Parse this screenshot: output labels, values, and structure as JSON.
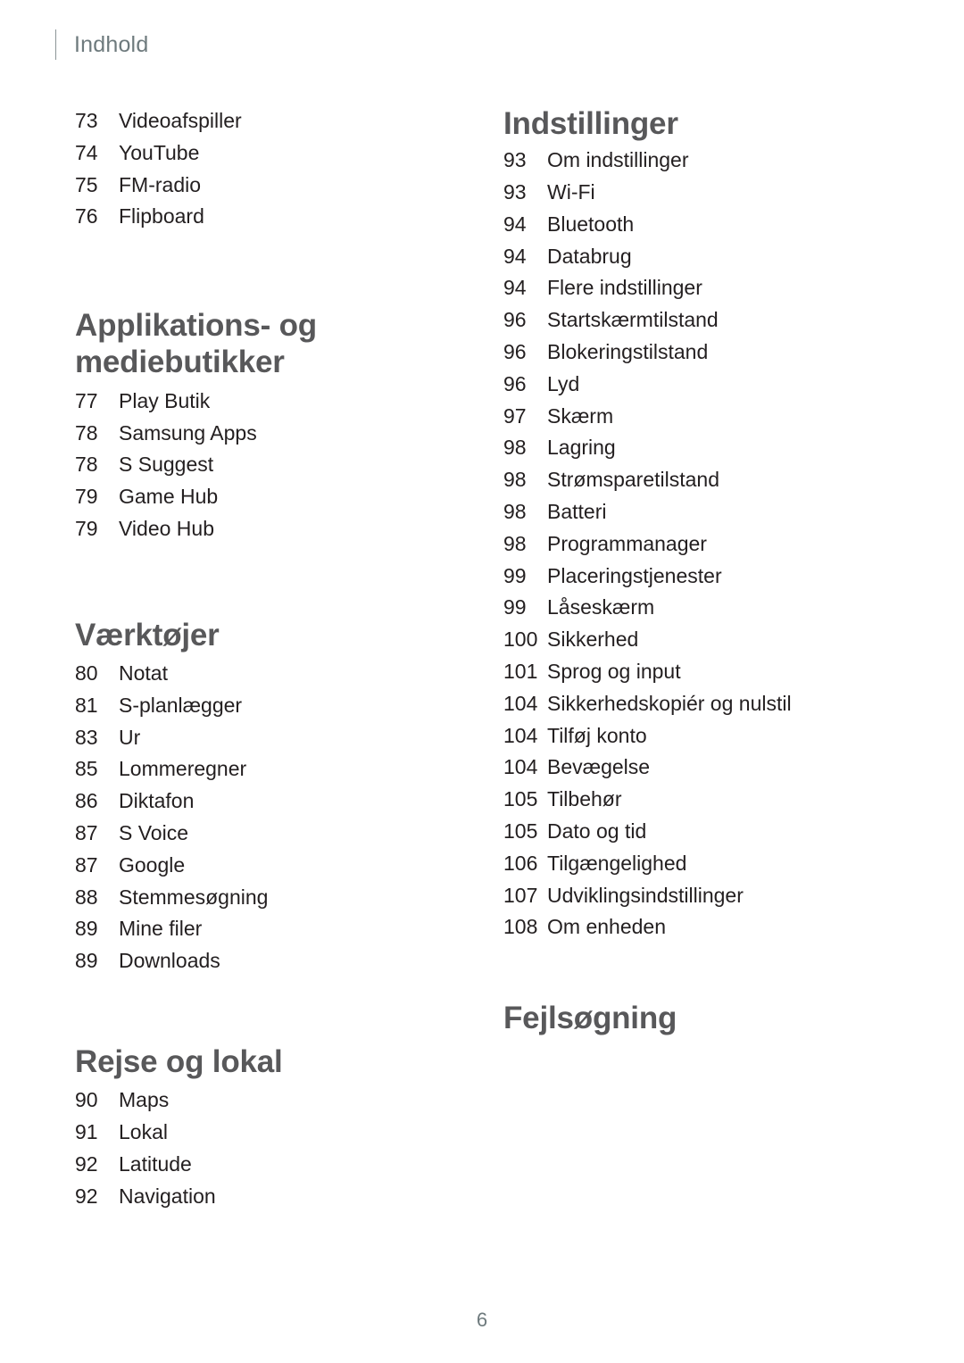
{
  "header": {
    "title": "Indhold"
  },
  "folio": {
    "page_number": "6"
  },
  "colors": {
    "heading": "#58585a",
    "body_text": "#231f20",
    "header_text": "#6e7a7d",
    "rule": "#8c9597",
    "background": "#ffffff"
  },
  "left_column": {
    "intro_entries": [
      {
        "page": "73",
        "label": "Videoafspiller"
      },
      {
        "page": "74",
        "label": "YouTube"
      },
      {
        "page": "75",
        "label": "FM-radio"
      },
      {
        "page": "76",
        "label": "Flipboard"
      }
    ],
    "sections": [
      {
        "heading": "Applikations- og mediebutikker",
        "heading_line_1": "Applikations- og",
        "heading_line_2": "mediebutikker",
        "entries": [
          {
            "page": "77",
            "label": "Play Butik"
          },
          {
            "page": "78",
            "label": "Samsung Apps"
          },
          {
            "page": "78",
            "label": "S Suggest"
          },
          {
            "page": "79",
            "label": "Game Hub"
          },
          {
            "page": "79",
            "label": "Video Hub"
          }
        ]
      },
      {
        "heading": "Værktøjer",
        "entries": [
          {
            "page": "80",
            "label": "Notat"
          },
          {
            "page": "81",
            "label": "S-planlægger"
          },
          {
            "page": "83",
            "label": "Ur"
          },
          {
            "page": "85",
            "label": "Lommeregner"
          },
          {
            "page": "86",
            "label": "Diktafon"
          },
          {
            "page": "87",
            "label": "S Voice"
          },
          {
            "page": "87",
            "label": "Google"
          },
          {
            "page": "88",
            "label": "Stemmesøgning"
          },
          {
            "page": "89",
            "label": "Mine filer"
          },
          {
            "page": "89",
            "label": "Downloads"
          }
        ]
      },
      {
        "heading": "Rejse og lokal",
        "entries": [
          {
            "page": "90",
            "label": "Maps"
          },
          {
            "page": "91",
            "label": "Lokal"
          },
          {
            "page": "92",
            "label": "Latitude"
          },
          {
            "page": "92",
            "label": "Navigation"
          }
        ]
      }
    ]
  },
  "right_column": {
    "sections": [
      {
        "heading": "Indstillinger",
        "entries": [
          {
            "page": "93",
            "label": "Om indstillinger"
          },
          {
            "page": "93",
            "label": "Wi-Fi"
          },
          {
            "page": "94",
            "label": "Bluetooth"
          },
          {
            "page": "94",
            "label": "Databrug"
          },
          {
            "page": "94",
            "label": "Flere indstillinger"
          },
          {
            "page": "96",
            "label": "Startskærmtilstand"
          },
          {
            "page": "96",
            "label": "Blokeringstilstand"
          },
          {
            "page": "96",
            "label": "Lyd"
          },
          {
            "page": "97",
            "label": "Skærm"
          },
          {
            "page": "98",
            "label": "Lagring"
          },
          {
            "page": "98",
            "label": "Strømsparetilstand"
          },
          {
            "page": "98",
            "label": "Batteri"
          },
          {
            "page": "98",
            "label": "Programmanager"
          },
          {
            "page": "99",
            "label": "Placeringstjenester"
          },
          {
            "page": "99",
            "label": "Låseskærm"
          },
          {
            "page": "100",
            "label": "Sikkerhed"
          },
          {
            "page": "101",
            "label": "Sprog og input"
          },
          {
            "page": "104",
            "label": "Sikkerhedskopiér og nulstil"
          },
          {
            "page": "104",
            "label": "Tilføj konto"
          },
          {
            "page": "104",
            "label": "Bevægelse"
          },
          {
            "page": "105",
            "label": "Tilbehør"
          },
          {
            "page": "105",
            "label": "Dato og tid"
          },
          {
            "page": "106",
            "label": "Tilgængelighed"
          },
          {
            "page": "107",
            "label": "Udviklingsindstillinger"
          },
          {
            "page": "108",
            "label": "Om enheden"
          }
        ]
      },
      {
        "heading": "Fejlsøgning",
        "entries": []
      }
    ]
  }
}
